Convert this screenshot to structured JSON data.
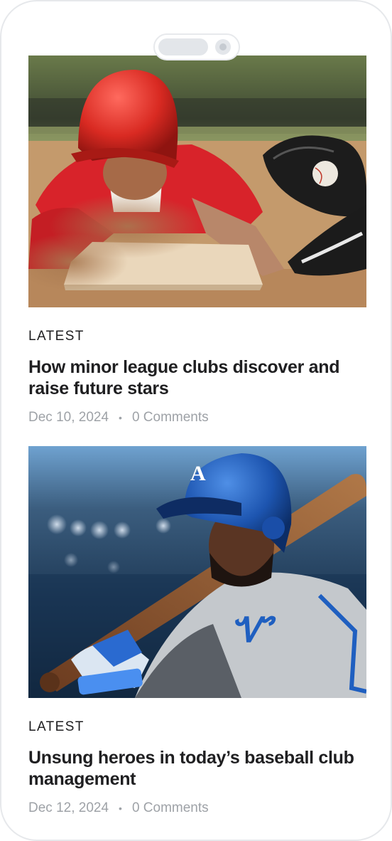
{
  "articles": [
    {
      "image": "baseball-player-sliding-into-base-photo",
      "category": "LATEST",
      "title": "How minor league clubs discover and raise future stars",
      "date": "Dec 10, 2024",
      "comments": "0 Comments"
    },
    {
      "image": "baseball-batter-blue-helmet-photo",
      "category": "LATEST",
      "title": "Unsung heroes in today’s baseball club management",
      "date": "Dec 12, 2024",
      "comments": "0 Comments"
    }
  ],
  "meta_separator": "•",
  "colors": {
    "text": "#1f1f21",
    "muted": "#9ea2a7",
    "frame": "#e6e8eb"
  }
}
